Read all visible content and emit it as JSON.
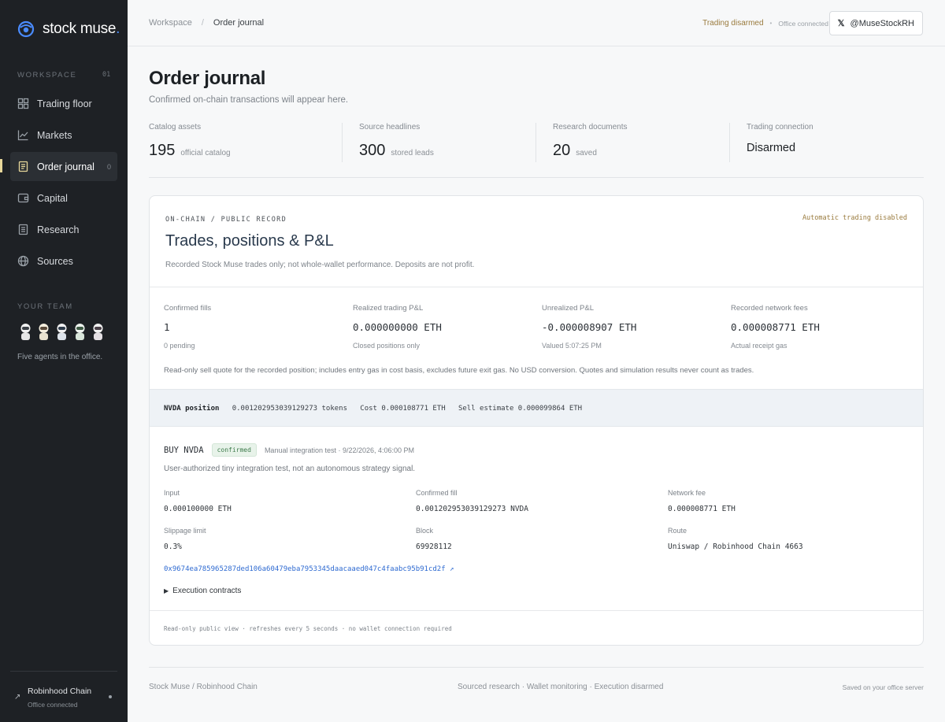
{
  "brand": {
    "name": "stock muse",
    "dot": "."
  },
  "sidebar": {
    "workspace_label": "WORKSPACE",
    "workspace_count": "01",
    "items": [
      {
        "label": "Trading floor",
        "icon": "grid-icon",
        "badge": ""
      },
      {
        "label": "Markets",
        "icon": "line-chart-icon",
        "badge": ""
      },
      {
        "label": "Order journal",
        "icon": "journal-icon",
        "badge": "0"
      },
      {
        "label": "Capital",
        "icon": "wallet-icon",
        "badge": ""
      },
      {
        "label": "Research",
        "icon": "document-icon",
        "badge": ""
      },
      {
        "label": "Sources",
        "icon": "globe-icon",
        "badge": ""
      }
    ],
    "team_label": "YOUR TEAM",
    "team_note": "Five agents in the office.",
    "chain_name": "Robinhood Chain",
    "chain_status": "Office connected"
  },
  "topbar": {
    "crumb_root": "Workspace",
    "crumb_sep": "/",
    "crumb_current": "Order journal",
    "trading_status": "Trading disarmed",
    "status_sep": "•",
    "office_status": "Office connected",
    "handle": "@MuseStockRH"
  },
  "page": {
    "title": "Order journal",
    "subtitle": "Confirmed on-chain transactions will appear here."
  },
  "stats": [
    {
      "label": "Catalog assets",
      "value": "195",
      "note": "official catalog"
    },
    {
      "label": "Source headlines",
      "value": "300",
      "note": "stored leads"
    },
    {
      "label": "Research documents",
      "value": "20",
      "note": "saved"
    },
    {
      "label": "Trading connection",
      "value": "Disarmed",
      "note": ""
    }
  ],
  "card": {
    "eyebrow": "ON-CHAIN / PUBLIC RECORD",
    "auto_status": "Automatic trading disabled",
    "title": "Trades, positions & P&L",
    "note": "Recorded Stock Muse trades only; not whole-wallet performance. Deposits are not profit.",
    "metrics": [
      {
        "label": "Confirmed fills",
        "value": "1",
        "sub": "0 pending"
      },
      {
        "label": "Realized trading P&L",
        "value": "0.000000000 ETH",
        "sub": "Closed positions only"
      },
      {
        "label": "Unrealized P&L",
        "value": "-0.000008907 ETH",
        "sub": "Valued 5:07:25 PM"
      },
      {
        "label": "Recorded network fees",
        "value": "0.000008771 ETH",
        "sub": "Actual receipt gas"
      }
    ],
    "disclaimer": "Read-only sell quote for the recorded position; includes entry gas in cost basis, excludes future exit gas. No USD conversion. Quotes and simulation results never count as trades.",
    "position": {
      "label": "NVDA position",
      "tokens": "0.001202953039129273 tokens",
      "cost": "Cost 0.000108771 ETH",
      "sell": "Sell estimate 0.000099864 ETH"
    },
    "trade": {
      "side": "BUY NVDA",
      "status": "confirmed",
      "meta": "Manual integration test · 9/22/2026, 4:06:00 PM",
      "note": "User-authorized tiny integration test, not an autonomous strategy signal.",
      "details": [
        {
          "label": "Input",
          "value": "0.000100000 ETH"
        },
        {
          "label": "Confirmed fill",
          "value": "0.001202953039129273 NVDA"
        },
        {
          "label": "Network fee",
          "value": "0.000008771 ETH"
        },
        {
          "label": "Slippage limit",
          "value": "0.3%"
        },
        {
          "label": "Block",
          "value": "69928112"
        },
        {
          "label": "Route",
          "value": "Uniswap / Robinhood Chain 4663"
        }
      ],
      "tx_hash": "0x9674ea785965287ded106a60479eba7953345daacaaed047c4faabc95b91cd2f ↗",
      "contracts_label": "Execution contracts"
    },
    "footer_note": "Read-only public view · refreshes every 5 seconds · no wallet connection required"
  },
  "footer": {
    "left": "Stock Muse / Robinhood Chain",
    "middle": "Sourced research · Wallet monitoring · Execution disarmed",
    "right": "Saved on your office server"
  },
  "colors": {
    "sidebar_bg": "#1e2125",
    "accent_gold": "#e7d79a",
    "link_blue": "#2e6ad1",
    "warning_brown": "#9a7b3e",
    "confirmed_green": "#3c7a4a"
  }
}
